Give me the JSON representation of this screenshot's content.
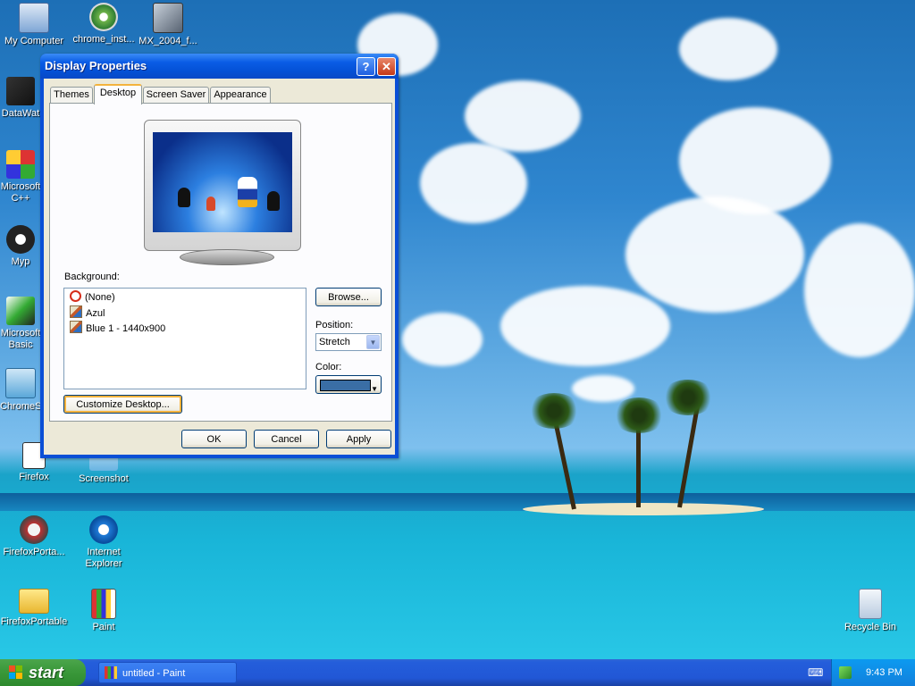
{
  "desktop": {
    "icons": [
      {
        "name": "my-computer-icon",
        "label": "My Computer"
      },
      {
        "name": "chrome-installer-icon",
        "label": "chrome_inst..."
      },
      {
        "name": "mx2004-icon",
        "label": "MX_2004_f..."
      },
      {
        "name": "datawatch-icon",
        "label": "DataWat"
      },
      {
        "name": "ms-visual-cpp-icon",
        "label": "Microsoft\nC++"
      },
      {
        "name": "myp-icon",
        "label": "Myp"
      },
      {
        "name": "ms-visual-basic-icon",
        "label": "Microsoft\nBasic"
      },
      {
        "name": "chromes-icon",
        "label": "ChromeS"
      },
      {
        "name": "firefox-icon",
        "label": "Firefox"
      },
      {
        "name": "screenshot-icon",
        "label": "Screenshot"
      },
      {
        "name": "firefoxportable-shortcut-icon",
        "label": "FirefoxPorta..."
      },
      {
        "name": "internet-explorer-icon",
        "label": "Internet\nExplorer"
      },
      {
        "name": "firefoxportable-folder-icon",
        "label": "FirefoxPortable"
      },
      {
        "name": "paint-icon",
        "label": "Paint"
      },
      {
        "name": "recycle-bin-icon",
        "label": "Recycle Bin"
      }
    ]
  },
  "window": {
    "title": "Display Properties",
    "help_label": "?",
    "close_label": "✕",
    "tabs": [
      {
        "label": "Themes",
        "active": false
      },
      {
        "label": "Desktop",
        "active": true
      },
      {
        "label": "Screen Saver",
        "active": false
      },
      {
        "label": "Appearance",
        "active": false
      }
    ],
    "background_label": "Background:",
    "background_items": [
      {
        "label": "(None)",
        "icon": "none-icon"
      },
      {
        "label": "Azul",
        "icon": "image-file-icon"
      },
      {
        "label": "Blue 1 - 1440x900",
        "icon": "image-file-icon"
      }
    ],
    "browse_label": "Browse...",
    "position_label": "Position:",
    "position_value": "Stretch",
    "color_label": "Color:",
    "color_value": "#3a6ea5",
    "customize_label": "Customize Desktop...",
    "ok_label": "OK",
    "cancel_label": "Cancel",
    "apply_label": "Apply"
  },
  "taskbar": {
    "start_label": "start",
    "tasks": [
      {
        "label": "untitled - Paint"
      }
    ],
    "clock": "9:43 PM"
  }
}
